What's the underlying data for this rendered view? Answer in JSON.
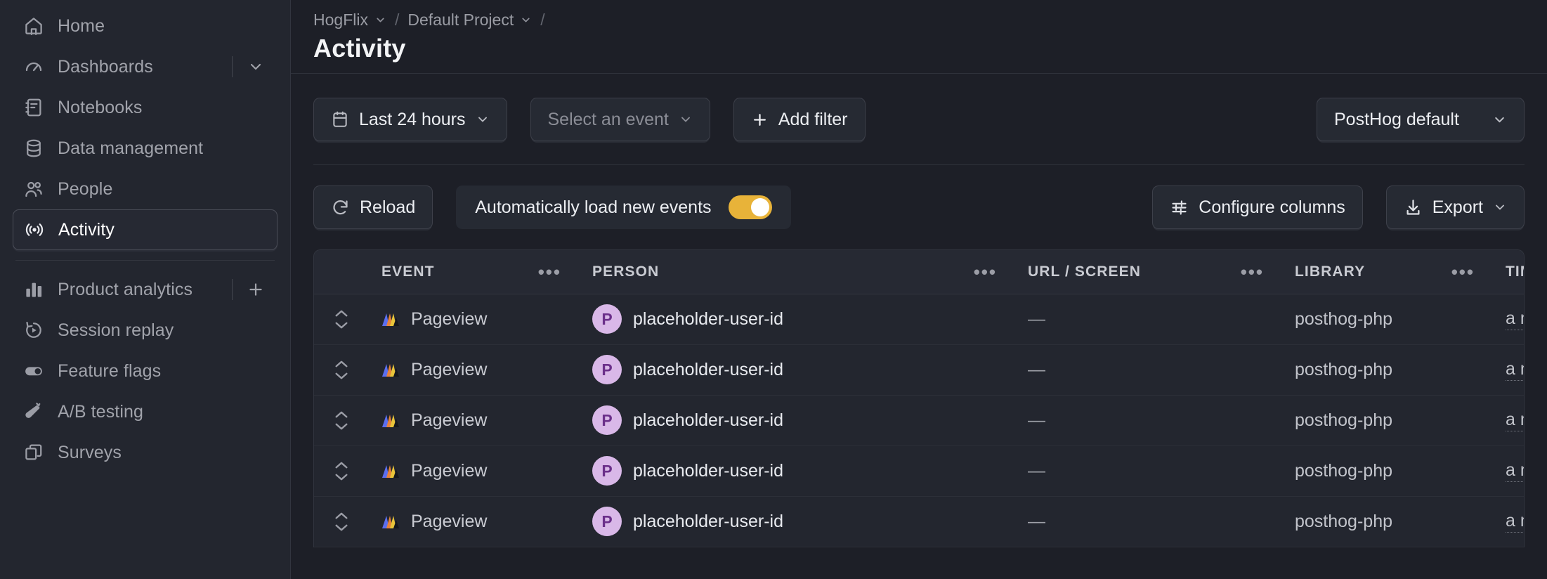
{
  "sidebar": {
    "primary_items": [
      {
        "label": "Home",
        "icon": "home-icon"
      },
      {
        "label": "Dashboards",
        "icon": "dashboard-gauge-icon",
        "trailing": "chevron-down-icon"
      },
      {
        "label": "Notebooks",
        "icon": "notebook-icon"
      },
      {
        "label": "Data management",
        "icon": "database-icon"
      },
      {
        "label": "People",
        "icon": "people-icon"
      },
      {
        "label": "Activity",
        "icon": "activity-broadcast-icon",
        "active": true
      }
    ],
    "secondary_items": [
      {
        "label": "Product analytics",
        "icon": "bar-chart-icon",
        "trailing": "plus-icon"
      },
      {
        "label": "Session replay",
        "icon": "replay-play-icon"
      },
      {
        "label": "Feature flags",
        "icon": "toggle-icon"
      },
      {
        "label": "A/B testing",
        "icon": "flask-icon"
      },
      {
        "label": "Surveys",
        "icon": "surveys-stack-icon"
      }
    ]
  },
  "breadcrumb": {
    "organization": "HogFlix",
    "project": "Default Project",
    "separator": "/"
  },
  "header": {
    "title": "Activity"
  },
  "filters": {
    "date_range": "Last 24 hours",
    "date_icon": "calendar-icon",
    "event_placeholder": "Select an event",
    "add_filter": "Add filter",
    "add_filter_icon": "plus-icon",
    "data_source": "PostHog default"
  },
  "toolbar": {
    "reload": "Reload",
    "reload_icon": "refresh-icon",
    "autoload_label": "Automatically load new events",
    "autoload_on": true,
    "configure_columns": "Configure columns",
    "configure_icon": "sliders-icon",
    "export": "Export",
    "export_icon": "download-icon"
  },
  "table": {
    "columns": [
      {
        "key": "event",
        "label": "Event"
      },
      {
        "key": "person",
        "label": "Person"
      },
      {
        "key": "url",
        "label": "URL / Screen"
      },
      {
        "key": "library",
        "label": "Library"
      },
      {
        "key": "time",
        "label": "Time"
      }
    ],
    "column_menu_icon": "ellipsis-icon",
    "rows": [
      {
        "event": "Pageview",
        "event_icon": "pageview-icon",
        "avatar_initial": "P",
        "person": "placeholder-user-id",
        "url": "—",
        "library": "posthog-php",
        "time": "a minute ago"
      },
      {
        "event": "Pageview",
        "event_icon": "pageview-icon",
        "avatar_initial": "P",
        "person": "placeholder-user-id",
        "url": "—",
        "library": "posthog-php",
        "time": "a minute ago"
      },
      {
        "event": "Pageview",
        "event_icon": "pageview-icon",
        "avatar_initial": "P",
        "person": "placeholder-user-id",
        "url": "—",
        "library": "posthog-php",
        "time": "a minute ago"
      },
      {
        "event": "Pageview",
        "event_icon": "pageview-icon",
        "avatar_initial": "P",
        "person": "placeholder-user-id",
        "url": "—",
        "library": "posthog-php",
        "time": "a minute ago"
      },
      {
        "event": "Pageview",
        "event_icon": "pageview-icon",
        "avatar_initial": "P",
        "person": "placeholder-user-id",
        "url": "—",
        "library": "posthog-php",
        "time": "a minute ago"
      }
    ]
  },
  "colors": {
    "accent_toggle": "#e8b339",
    "avatar_bg": "#d9b8e8",
    "avatar_fg": "#6b2f8a",
    "sidebar_bg": "#23262f",
    "main_bg": "#1d1f27"
  }
}
